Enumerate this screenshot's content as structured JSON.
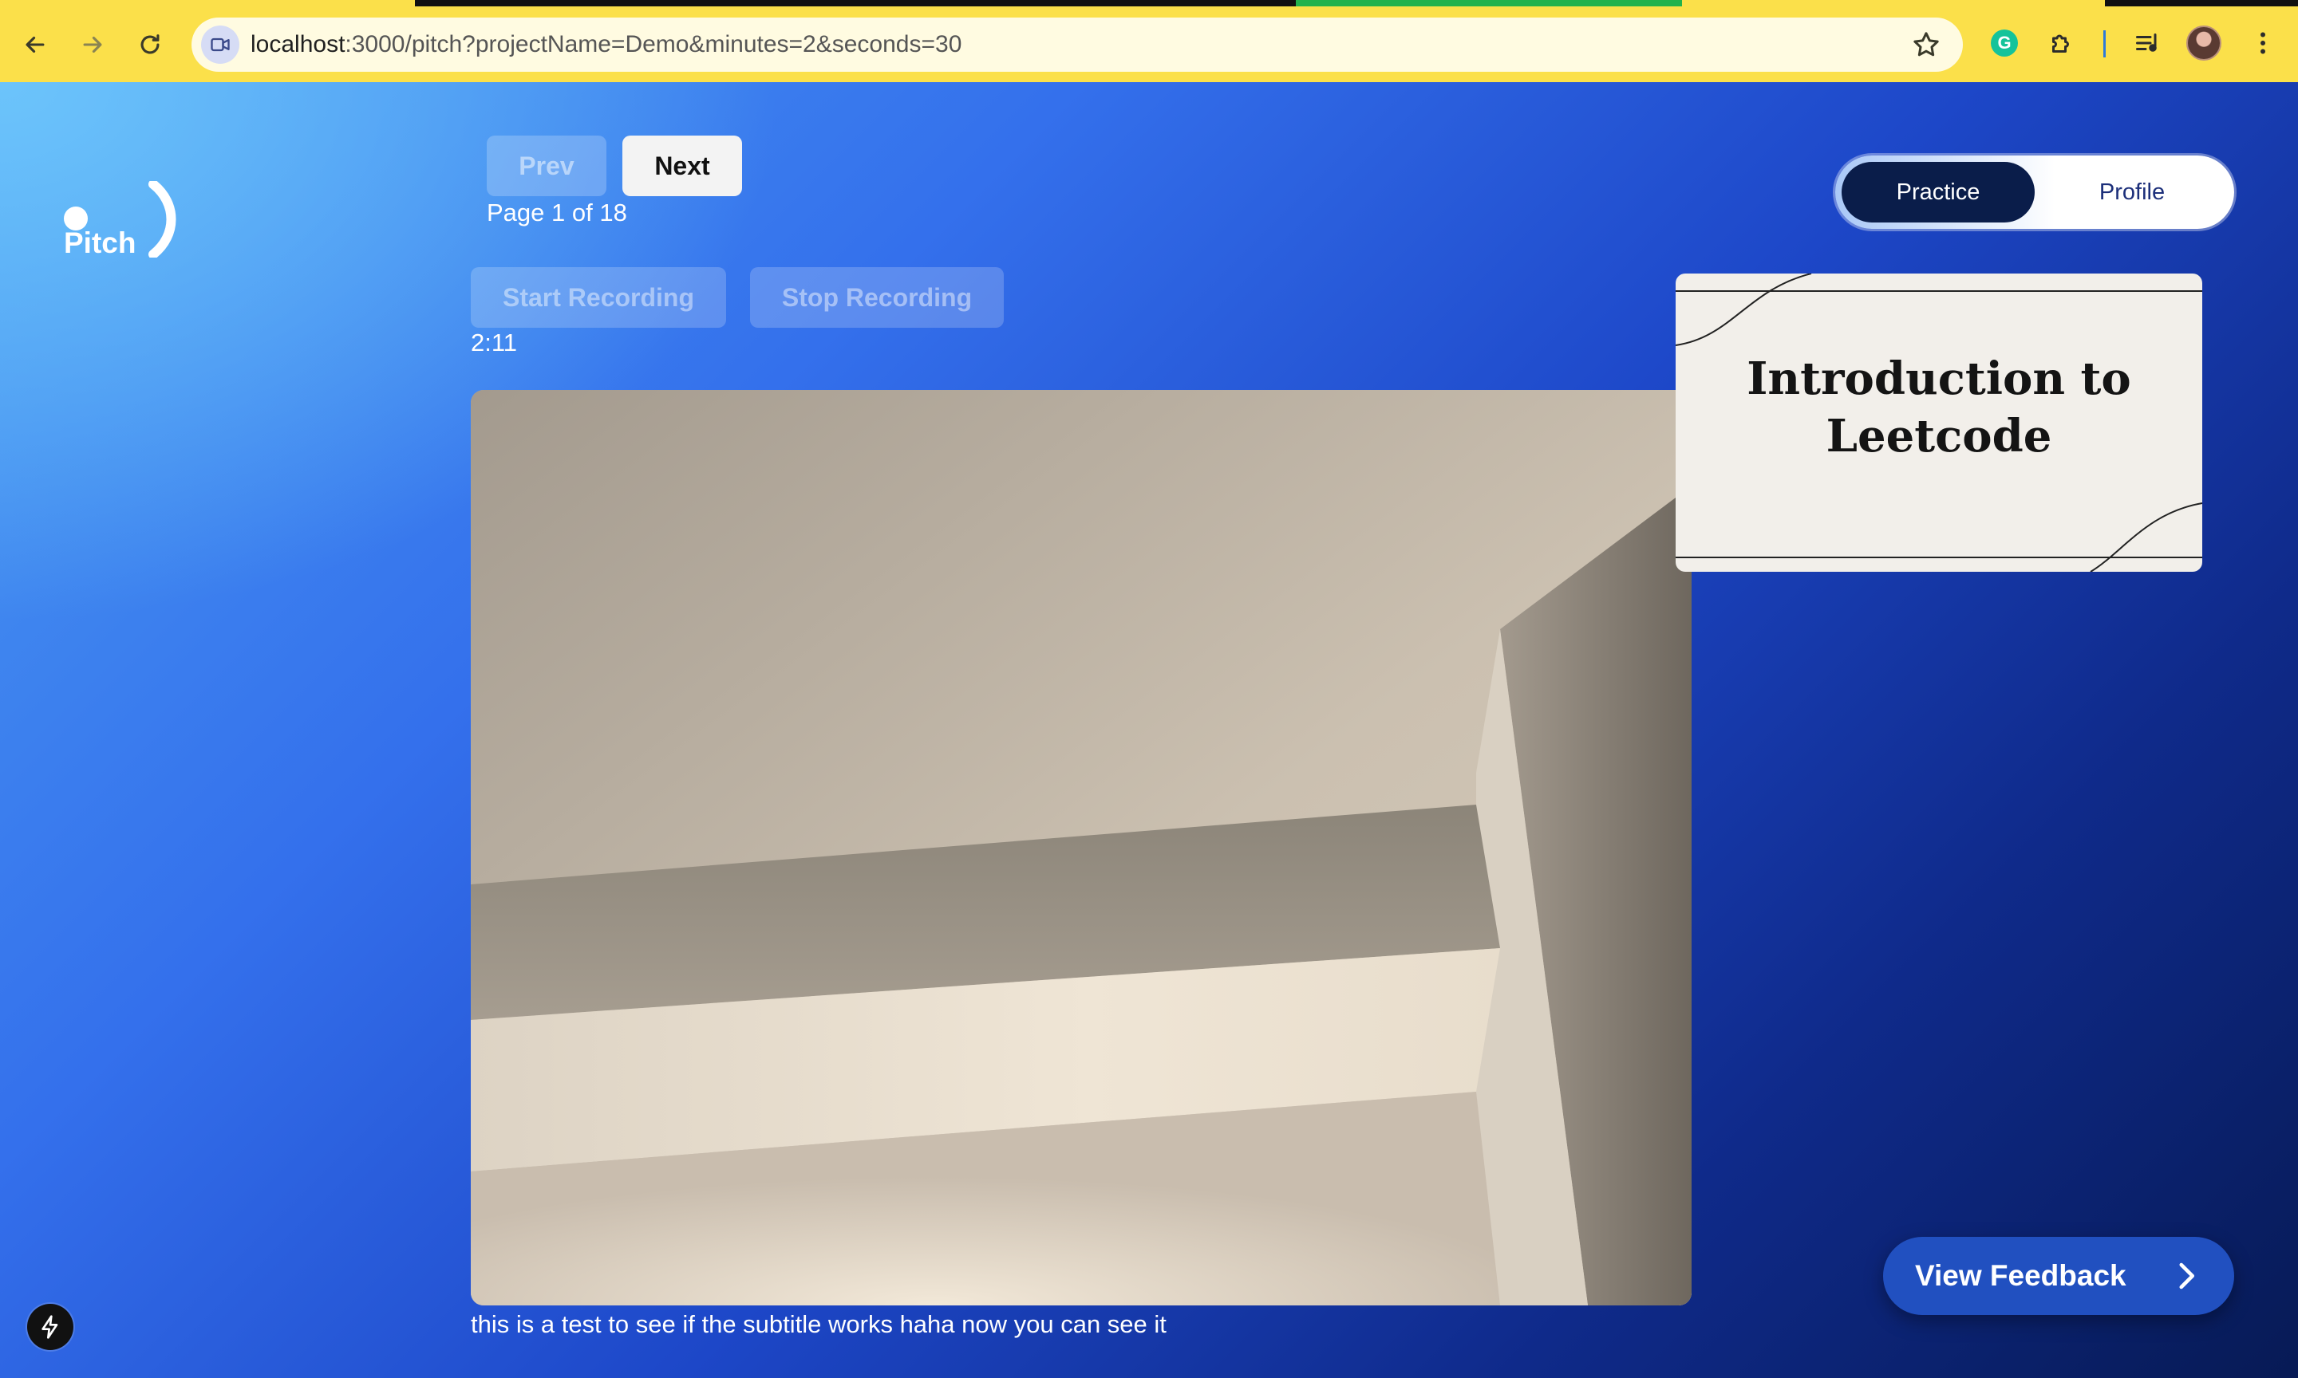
{
  "browser": {
    "url_host": "localhost",
    "url_path": ":3000/pitch?projectName=Demo&minutes=2&seconds=30"
  },
  "sidebar": {
    "brand_name": "Pitch"
  },
  "controls": {
    "prev_label": "Prev",
    "next_label": "Next",
    "page_indicator": "Page 1 of 18",
    "start_recording_label": "Start Recording",
    "stop_recording_label": "Stop Recording",
    "timer": "2:11"
  },
  "mode_toggle": {
    "options": [
      "Practice",
      "Profile"
    ],
    "selected": "Practice"
  },
  "slide_preview": {
    "title": "Introduction to Leetcode"
  },
  "subtitle": "this is a test to see if the subtitle works haha now you can see it",
  "feedback_button": {
    "label": "View Feedback"
  },
  "colors": {
    "accent_dark": "#0a1d4a",
    "feedback_button": "#2150c0",
    "browser_chrome": "#fbe04a"
  },
  "icons": [
    "back-arrow-icon",
    "forward-arrow-icon",
    "reload-icon",
    "site-info-icon",
    "bookmark-star-icon",
    "grammarly-icon",
    "extensions-puzzle-icon",
    "media-controls-icon",
    "profile-avatar",
    "more-menu-icon",
    "chevron-right-icon",
    "lightning-icon"
  ]
}
